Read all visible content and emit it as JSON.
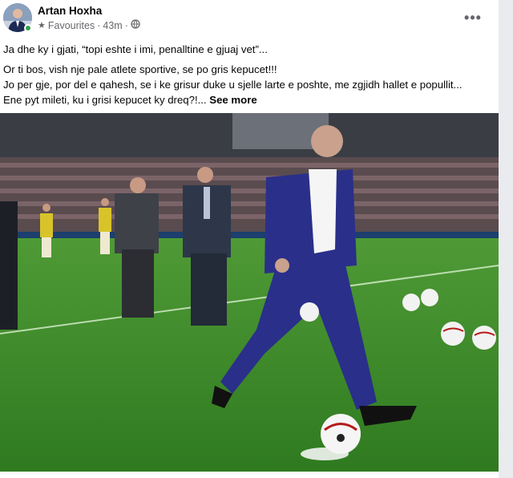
{
  "post": {
    "author": "Artan Hoxha",
    "audience": "Favourites",
    "separator": "·",
    "time": "43m",
    "separator2": "·",
    "text_line1": "Ja dhe ky i gjati, “topi eshte i imi, penalltine e gjuaj vet”...",
    "text_line2": "Or ti bos, vish nje pale atlete sportive, se po gris kepucet!!!",
    "text_line3": "Jo per gje, por del e qahesh, se i ke grisur duke u sjelle larte e poshte, me zgjidh hallet e popullit...",
    "text_line4": "Ene pyt mileti, ku i grisi kepucet ky dreq?!...",
    "see_more": "See more",
    "more_options": "•••"
  },
  "icons": {
    "audience": "star-icon",
    "privacy": "globe-icon",
    "options": "more-options-icon"
  },
  "colors": {
    "text": "#050505",
    "secondary_text": "#65676b",
    "online": "#31a24c",
    "pitch": "#3a7d2a",
    "suit": "#2a2f8a"
  }
}
